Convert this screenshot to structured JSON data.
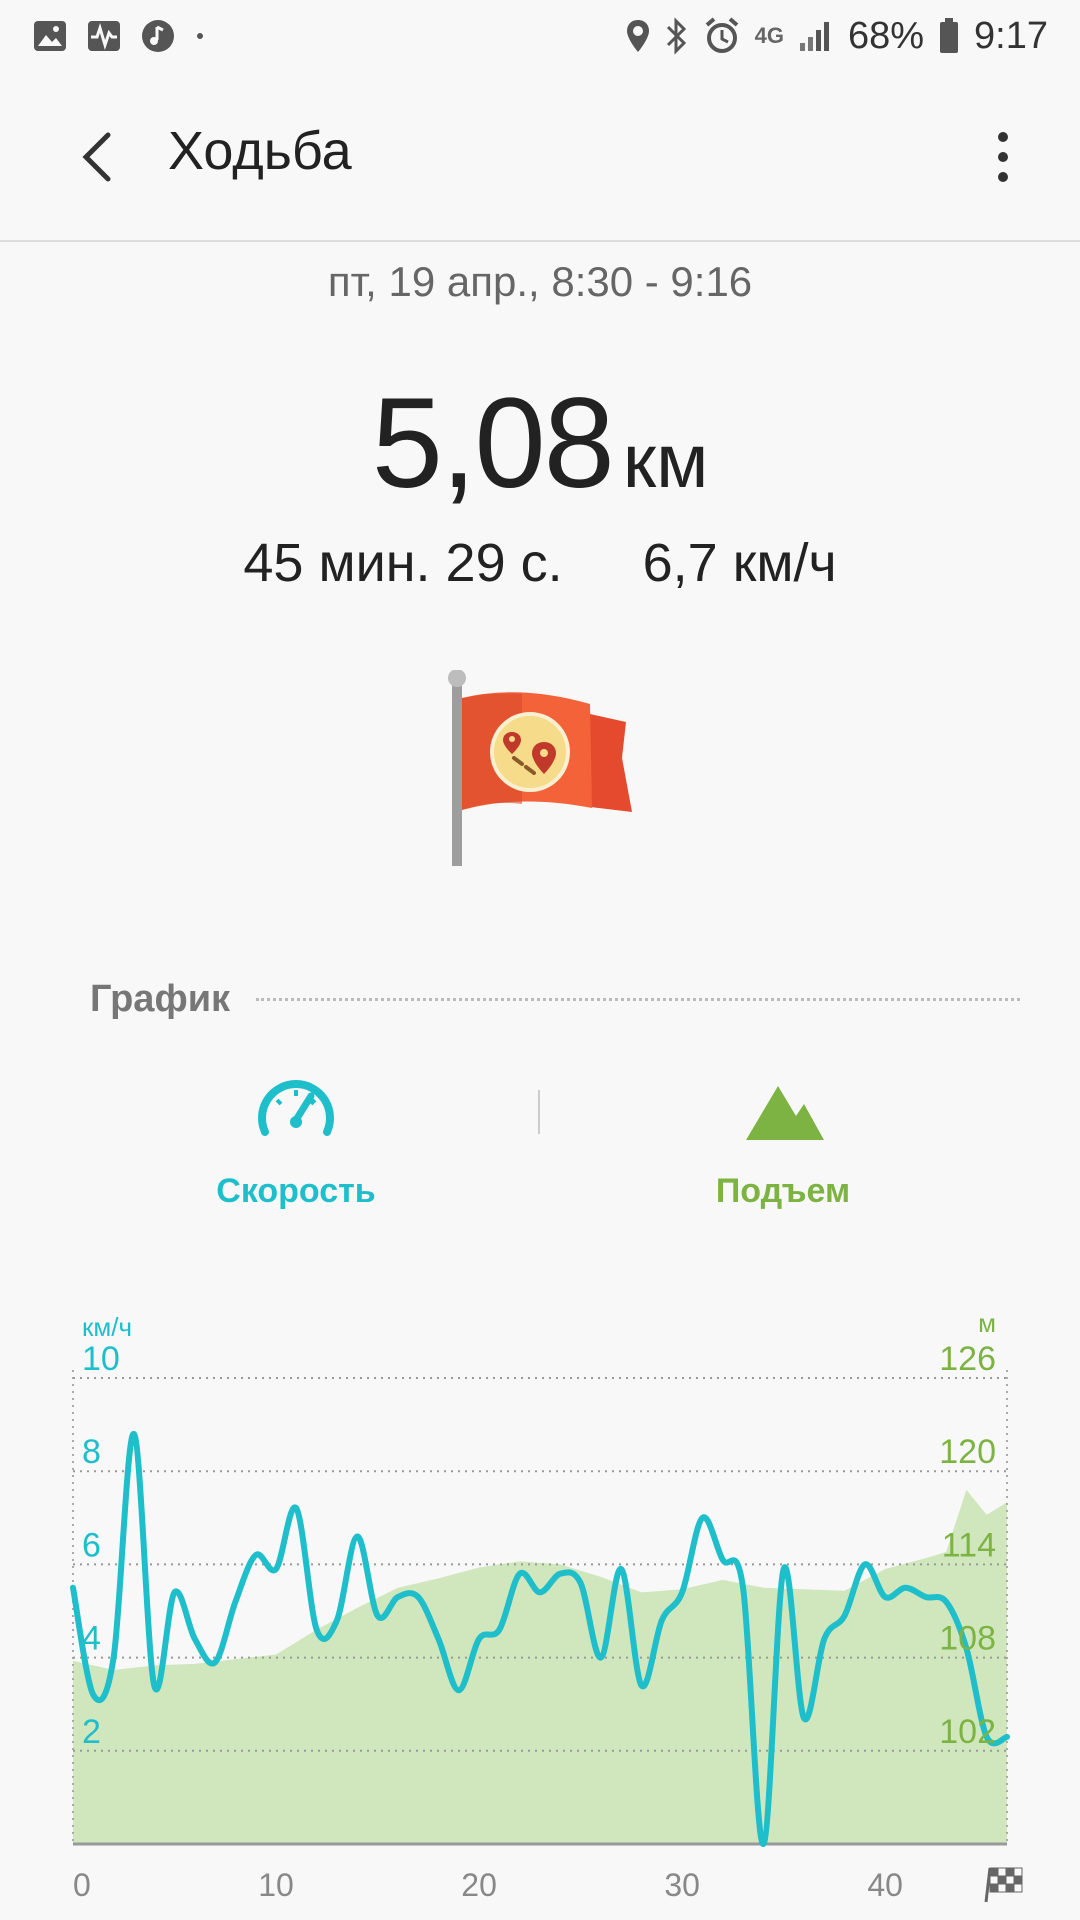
{
  "status_bar": {
    "left_icons": [
      "gallery-icon",
      "health-icon",
      "music-icon",
      "dot-icon"
    ],
    "right_icons": [
      "location-icon",
      "bluetooth-icon",
      "alarm-icon"
    ],
    "network": "4G",
    "battery": "68%",
    "time": "9:17"
  },
  "app_bar": {
    "title": "Ходьба"
  },
  "workout": {
    "date_range": "пт, 19 апр., 8:30 - 9:16",
    "distance_value": "5,08",
    "distance_unit": "км",
    "duration": "45 мин. 29 с.",
    "avg_speed": "6,7 км/ч"
  },
  "graph_section": {
    "title": "График",
    "tabs": [
      {
        "label": "Скорость",
        "icon": "speedometer-icon",
        "color": "#1fbecb"
      },
      {
        "label": "Подъем",
        "icon": "mountain-icon",
        "color": "#7cb342"
      }
    ]
  },
  "chart_data": {
    "type": "line",
    "left_unit": "км/ч",
    "right_unit": "м",
    "x_ticks": [
      "0",
      "10",
      "20",
      "30",
      "40"
    ],
    "x_range": [
      0,
      46
    ],
    "left_ticks": [
      "10",
      "8",
      "6",
      "4",
      "2"
    ],
    "left_range": [
      0,
      10
    ],
    "right_ticks": [
      "126",
      "120",
      "114",
      "108",
      "102"
    ],
    "right_range": [
      96,
      126
    ],
    "series": [
      {
        "name": "Скорость",
        "axis": "left",
        "color": "#1fbecb",
        "x": [
          0,
          1,
          2,
          3,
          4,
          5,
          6,
          7,
          8,
          9,
          10,
          11,
          12,
          13,
          14,
          15,
          16,
          17,
          18,
          19,
          20,
          21,
          22,
          23,
          24,
          25,
          26,
          27,
          28,
          29,
          30,
          31,
          32,
          33,
          34,
          35,
          36,
          37,
          38,
          39,
          40,
          41,
          42,
          43,
          44,
          45,
          46
        ],
        "values": [
          5.5,
          3.2,
          4.0,
          8.8,
          3.4,
          5.4,
          4.4,
          3.9,
          5.2,
          6.2,
          5.9,
          7.2,
          4.6,
          4.8,
          6.6,
          4.9,
          5.3,
          5.3,
          4.4,
          3.3,
          4.4,
          4.6,
          5.8,
          5.4,
          5.8,
          5.6,
          4.0,
          5.9,
          3.4,
          4.8,
          5.4,
          7.0,
          6.1,
          5.5,
          0.0,
          5.9,
          2.7,
          4.4,
          4.9,
          6.0,
          5.3,
          5.5,
          5.3,
          5.2,
          4.2,
          2.3,
          2.3
        ]
      },
      {
        "name": "Подъем",
        "axis": "right",
        "color": "#c9e4b4",
        "x": [
          0,
          2,
          4,
          6,
          8,
          10,
          12,
          14,
          16,
          18,
          20,
          22,
          24,
          26,
          28,
          30,
          32,
          34,
          36,
          38,
          40,
          42,
          43,
          44,
          45,
          46
        ],
        "values": [
          107.8,
          107.2,
          107.5,
          107.6,
          107.9,
          108.2,
          109.8,
          111.2,
          112.5,
          113.1,
          113.8,
          114.2,
          114.0,
          113.2,
          112.2,
          112.4,
          113.0,
          112.5,
          112.4,
          112.3,
          113.7,
          114.4,
          114.8,
          118.8,
          117.2,
          118.0
        ]
      }
    ],
    "grid": true
  }
}
